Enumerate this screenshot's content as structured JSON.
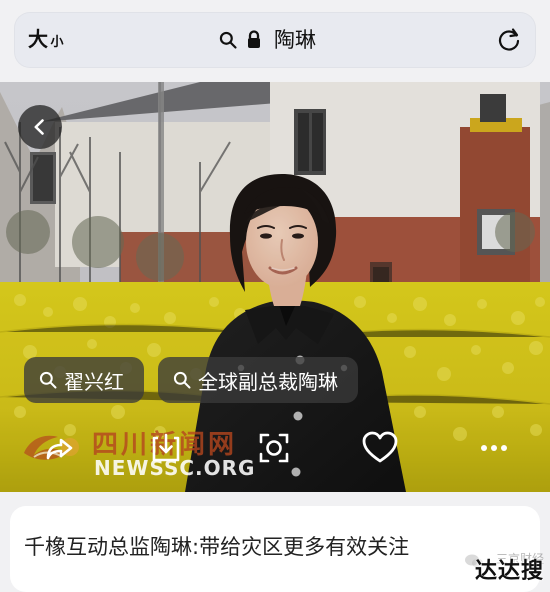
{
  "address_bar": {
    "text_size_large": "大",
    "text_size_small": "小",
    "url_text": "陶琳",
    "icons": {
      "search": "search-icon",
      "lock": "lock-icon",
      "reload": "reload-icon"
    }
  },
  "image_viewer": {
    "back_icon": "chevron-left-icon",
    "search_chips": [
      {
        "label": "翟兴红"
      },
      {
        "label": "全球副总裁陶琳"
      }
    ],
    "watermark": {
      "cn": "四川新闻网",
      "en": "NEWSSC.ORG"
    },
    "actions": [
      {
        "name": "share",
        "icon": "share-icon"
      },
      {
        "name": "save",
        "icon": "download-icon"
      },
      {
        "name": "lens",
        "icon": "camera-lens-icon"
      },
      {
        "name": "like",
        "icon": "heart-icon"
      },
      {
        "name": "more",
        "icon": "more-icon"
      }
    ]
  },
  "result_card": {
    "title": "千橡互动总监陶琳:带给灾区更多有效关注"
  },
  "footer_watermark": {
    "brand": "达达搜",
    "faint": "三京财经"
  },
  "colors": {
    "address_bar_bg": "#e8eaf0",
    "page_bg": "#f1f1f3",
    "chip_bg": "#3a3a3a",
    "field_yellow": "#e9d21f",
    "watermark_red": "#b4461e"
  }
}
